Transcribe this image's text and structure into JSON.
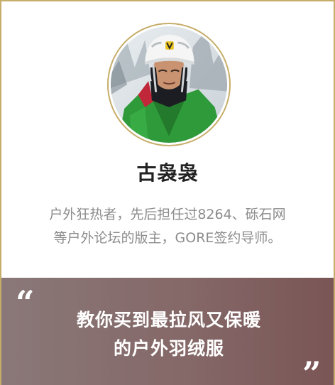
{
  "profile": {
    "name": "古袅袅",
    "bio_lines": [
      "户外狂热者，先后担任过8264、砾石网",
      "等户外论坛的版主，GORE签约导师。"
    ]
  },
  "banner": {
    "open_quote": "“",
    "close_quote": "”",
    "headline_lines": [
      "教你买到最拉风又保暖",
      "的户外羽绒服"
    ]
  },
  "colors": {
    "border_gold": "#c6ad6a",
    "banner_start": "#8a7878",
    "banner_end": "#7a5555",
    "name_text": "#222222",
    "bio_text": "#8c8c8c"
  }
}
